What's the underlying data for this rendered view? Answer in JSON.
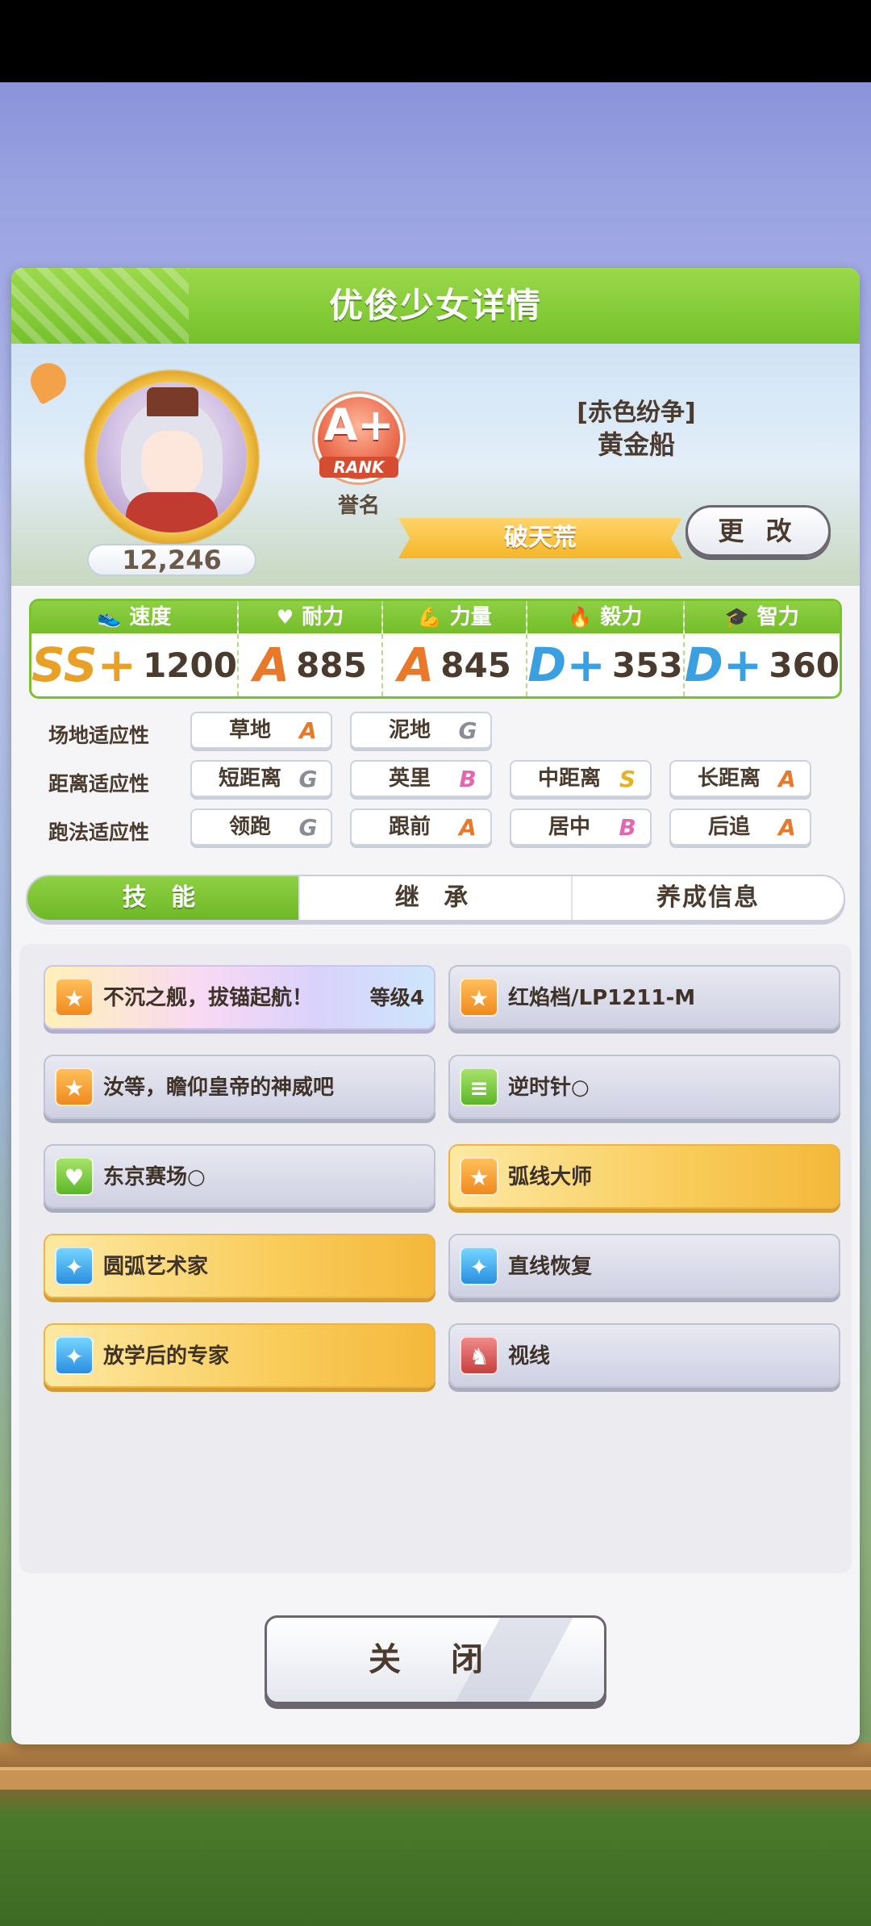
{
  "dialog": {
    "title": "优俊少女详情"
  },
  "profile": {
    "fans_count": "12,246",
    "rank": {
      "grade": "A+",
      "word": "RANK",
      "label": "誉名"
    },
    "epithet": "[赤色纷争]",
    "name": "黄金船",
    "title_banner": "破天荒",
    "change_button": "更 改"
  },
  "stats": [
    {
      "label": "速度",
      "icon": "shoe-icon",
      "grade": "SS+",
      "value": "1200",
      "grade_color": "#e8a126"
    },
    {
      "label": "耐力",
      "icon": "heart-icon",
      "grade": "A",
      "value": "885",
      "grade_color": "#e8782a"
    },
    {
      "label": "力量",
      "icon": "muscle-icon",
      "grade": "A",
      "value": "845",
      "grade_color": "#e8782a"
    },
    {
      "label": "毅力",
      "icon": "flame-icon",
      "grade": "D+",
      "value": "353",
      "grade_color": "#3aa0e0"
    },
    {
      "label": "智力",
      "icon": "graduation-cap-icon",
      "grade": "D+",
      "value": "360",
      "grade_color": "#3aa0e0"
    }
  ],
  "aptitudes": [
    {
      "label": "场地适应性",
      "items": [
        {
          "name": "草地",
          "grade": "A",
          "color": "#e8782a"
        },
        {
          "name": "泥地",
          "grade": "G",
          "color": "#8a8d96"
        }
      ]
    },
    {
      "label": "距离适应性",
      "items": [
        {
          "name": "短距离",
          "grade": "G",
          "color": "#8a8d96"
        },
        {
          "name": "英里",
          "grade": "B",
          "color": "#e566b0"
        },
        {
          "name": "中距离",
          "grade": "S",
          "color": "#e8b026"
        },
        {
          "name": "长距离",
          "grade": "A",
          "color": "#e8782a"
        }
      ]
    },
    {
      "label": "跑法适应性",
      "items": [
        {
          "name": "领跑",
          "grade": "G",
          "color": "#8a8d96"
        },
        {
          "name": "跟前",
          "grade": "A",
          "color": "#e8782a"
        },
        {
          "name": "居中",
          "grade": "B",
          "color": "#e566b0"
        },
        {
          "name": "后追",
          "grade": "A",
          "color": "#e8782a"
        }
      ]
    }
  ],
  "tabs": [
    "技 能",
    "继 承",
    "养成信息"
  ],
  "skills": [
    {
      "name": "不沉之舰，拔锚起航！",
      "level": "等级4",
      "style": "rainbow",
      "icon": "runner-icon",
      "icon_color": "orange"
    },
    {
      "name": "红焰档/LP1211-M",
      "style": "silver",
      "icon": "runner-icon",
      "icon_color": "orange"
    },
    {
      "name": "汝等，瞻仰皇帝的神威吧",
      "style": "silver",
      "icon": "runner-icon",
      "icon_color": "orange"
    },
    {
      "name": "逆时针○",
      "style": "silver",
      "icon": "document-icon",
      "icon_color": "green"
    },
    {
      "name": "东京赛场○",
      "style": "silver",
      "icon": "heart-icon",
      "icon_color": "green"
    },
    {
      "name": "弧线大师",
      "style": "gold",
      "icon": "runner-icon",
      "icon_color": "orange"
    },
    {
      "name": "圆弧艺术家",
      "style": "gold",
      "icon": "sparkle-icon",
      "icon_color": "blue"
    },
    {
      "name": "直线恢复",
      "style": "silver",
      "icon": "sparkle-icon",
      "icon_color": "blue"
    },
    {
      "name": "放学后的专家",
      "style": "gold",
      "icon": "sparkle-icon",
      "icon_color": "blue"
    },
    {
      "name": "视线",
      "style": "silver",
      "icon": "horse-icon",
      "icon_color": "red"
    }
  ],
  "close_button": "关 闭"
}
